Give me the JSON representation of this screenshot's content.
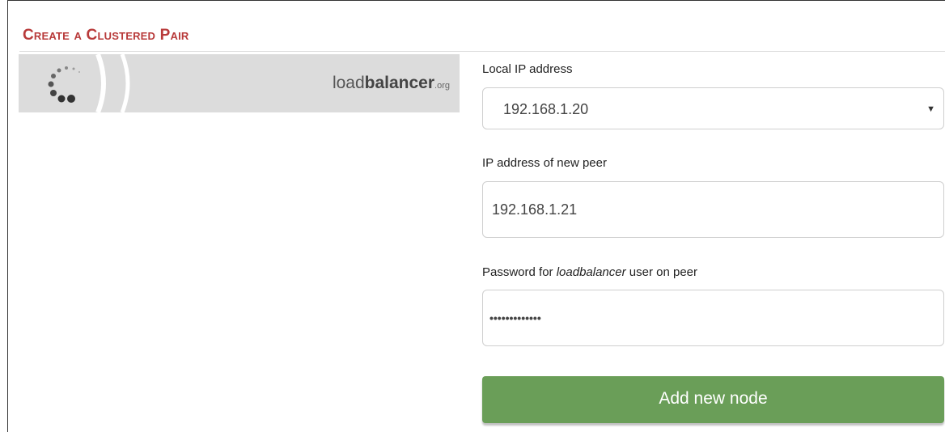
{
  "panel": {
    "title": "Create a Clustered Pair"
  },
  "banner": {
    "brand_light": "load",
    "brand_bold": "balancer",
    "brand_tld": ".org"
  },
  "form": {
    "local_ip": {
      "label": "Local IP address",
      "value": "192.168.1.20"
    },
    "peer_ip": {
      "label": "IP address of new peer",
      "value": "192.168.1.21"
    },
    "password": {
      "label_prefix": "Password for ",
      "label_italic": "loadbalancer",
      "label_suffix": " user on peer",
      "value_masked": "•••••••••••••"
    },
    "submit_label": "Add new node"
  },
  "colors": {
    "title": "#b83a3a",
    "button": "#6a9e58",
    "banner": "#dcdcdc"
  },
  "icons": [
    "loading-dots-icon",
    "dropdown-caret-icon"
  ]
}
